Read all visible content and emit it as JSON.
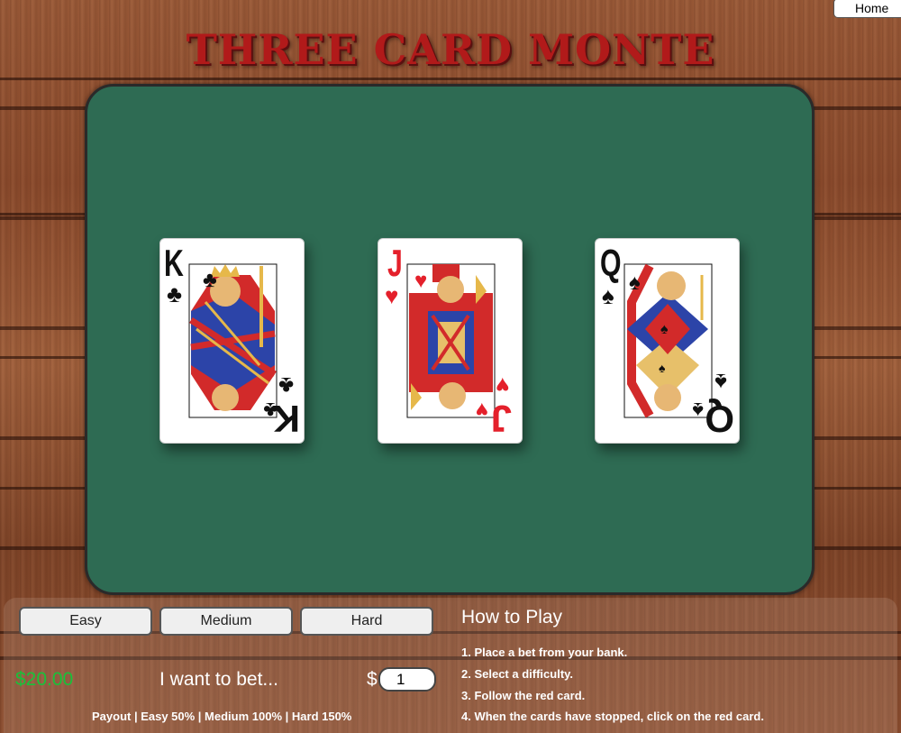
{
  "nav": {
    "home_label": "Home"
  },
  "title": "THREE CARD MONTE",
  "cards": [
    {
      "rank": "K",
      "suit": "♣",
      "color": "black",
      "label": "King of Clubs"
    },
    {
      "rank": "J",
      "suit": "♥",
      "color": "red",
      "label": "Jack of Hearts"
    },
    {
      "rank": "Q",
      "suit": "♠",
      "color": "black",
      "label": "Queen of Spades"
    }
  ],
  "difficulty": {
    "options": [
      "Easy",
      "Medium",
      "Hard"
    ]
  },
  "bank": {
    "amount": "$20.00"
  },
  "bet": {
    "label": "I want to bet...",
    "currency": "$",
    "value": "1"
  },
  "payout": "Payout | Easy 50% | Medium 100% | Hard 150%",
  "how_to_play": {
    "title": "How to Play",
    "steps": [
      "1. Place a bet from your bank.",
      "2. Select a difficulty.",
      "3. Follow the red card.",
      "4. When the cards have stopped, click on the red card."
    ]
  },
  "colors": {
    "felt": "#2e6b53",
    "title_red": "#b11a1a",
    "bank_green": "#18c23a",
    "card_red": "#e4202b"
  }
}
